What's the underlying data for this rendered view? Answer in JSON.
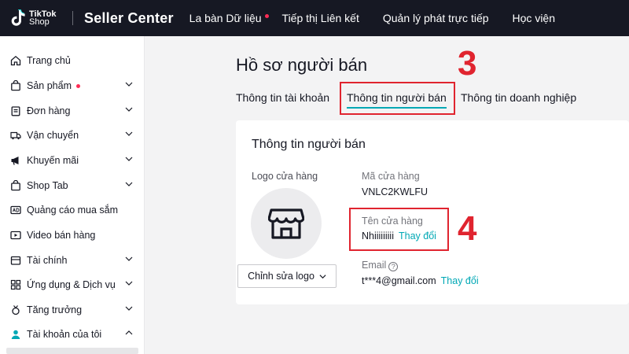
{
  "topbar": {
    "logo_line1": "TikTok",
    "logo_line2": "Shop",
    "brand": "Seller Center",
    "nav": [
      "La bàn Dữ liệu",
      "Tiếp thị Liên kết",
      "Quản lý phát trực tiếp",
      "Học viện"
    ]
  },
  "sidebar": {
    "items": [
      {
        "label": "Trang chủ",
        "icon": "home-icon"
      },
      {
        "label": "Sản phẩm",
        "icon": "bag-icon"
      },
      {
        "label": "Đơn hàng",
        "icon": "clipboard-icon"
      },
      {
        "label": "Vận chuyển",
        "icon": "truck-icon"
      },
      {
        "label": "Khuyến mãi",
        "icon": "megaphone-icon"
      },
      {
        "label": "Shop Tab",
        "icon": "bag-icon"
      },
      {
        "label": "Quảng cáo mua sắm",
        "icon": "ad-icon"
      },
      {
        "label": "Video bán hàng",
        "icon": "video-icon"
      },
      {
        "label": "Tài chính",
        "icon": "wallet-icon"
      },
      {
        "label": "Ứng dụng & Dịch vụ",
        "icon": "apps-icon"
      },
      {
        "label": "Tăng trưởng",
        "icon": "medal-icon"
      },
      {
        "label": "Tài khoản của tôi",
        "icon": "user-icon"
      }
    ]
  },
  "main": {
    "title": "Hồ sơ người bán",
    "tabs": [
      "Thông tin tài khoản",
      "Thông tin người bán",
      "Thông tin doanh nghiệp"
    ],
    "annotations": [
      "3",
      "4"
    ],
    "card": {
      "title": "Thông tin người bán",
      "logo_label": "Logo cửa hàng",
      "edit_logo_button": "Chỉnh sửa logo",
      "shop_code_label": "Mã cửa hàng",
      "shop_code_value": "VNLC2KWLFU",
      "shop_name_label": "Tên cửa hàng",
      "shop_name_value": "Nhiiiiiiiii",
      "change_link": "Thay đổi",
      "email_label": "Email",
      "email_value": "t***4@gmail.com"
    }
  },
  "colors": {
    "accent": "#00a8b5",
    "annotation": "#e0242f",
    "topbar": "#161823",
    "badge": "#fe2c55"
  }
}
